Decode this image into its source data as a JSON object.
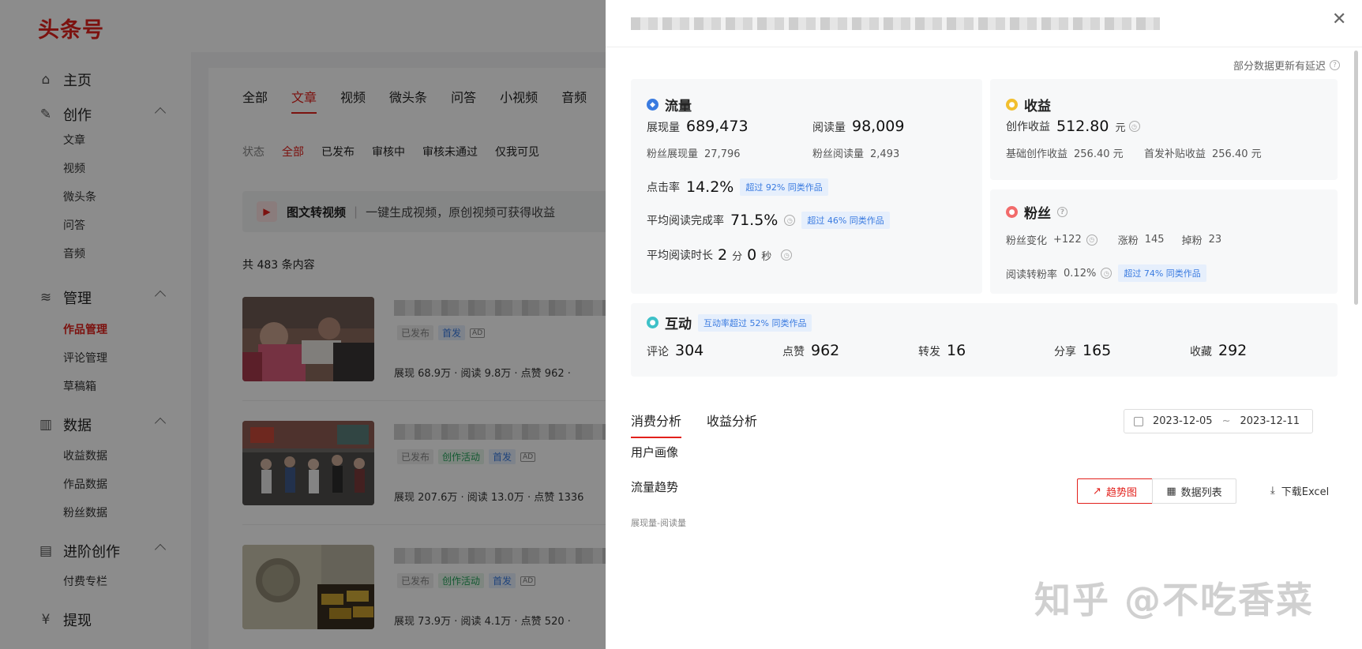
{
  "app": {
    "logo": "头条号",
    "sidebar": {
      "home": "主页",
      "create": "创作",
      "create_items": [
        "文章",
        "视频",
        "微头条",
        "问答",
        "音频"
      ],
      "manage": "管理",
      "manage_items": [
        "作品管理",
        "评论管理",
        "草稿箱"
      ],
      "data": "数据",
      "data_items": [
        "收益数据",
        "作品数据",
        "粉丝数据"
      ],
      "advanced": "进阶创作",
      "advanced_items": [
        "付费专栏"
      ],
      "withdraw": "提现"
    },
    "tabs": [
      "全部",
      "文章",
      "视频",
      "微头条",
      "问答",
      "小视频",
      "音频"
    ],
    "status_label": "状态",
    "status_filters": [
      "全部",
      "已发布",
      "审核中",
      "审核未通过",
      "仅我可见"
    ],
    "promo": {
      "title": "图文转视频",
      "desc": "一键生成视频，原创视频可获得收益"
    },
    "count": "共 483 条内容",
    "articles": [
      {
        "status": "已发布",
        "tags": [
          "首发"
        ],
        "ad": "AD",
        "stats": "展现 68.9万 · 阅读 9.8万 · 点赞 962 ·"
      },
      {
        "status": "已发布",
        "tags": [
          "创作活动",
          "首发"
        ],
        "ad": "AD",
        "stats": "展现 207.6万 · 阅读 13.0万 · 点赞 1336"
      },
      {
        "status": "已发布",
        "tags": [
          "创作活动",
          "首发"
        ],
        "ad": "AD",
        "stats": "展现 73.9万 · 阅读 4.1万 · 点赞 520 ·"
      }
    ]
  },
  "drawer": {
    "delay_note": "部分数据更新有延迟",
    "traffic": {
      "title": "流量",
      "impressions_label": "展现量",
      "impressions": "689,473",
      "reads_label": "阅读量",
      "reads": "98,009",
      "fan_impressions_label": "粉丝展现量",
      "fan_impressions": "27,796",
      "fan_reads_label": "粉丝阅读量",
      "fan_reads": "2,493",
      "ctr_label": "点击率",
      "ctr": "14.2%",
      "ctr_badge": "超过 92% 同类作品",
      "completion_label": "平均阅读完成率",
      "completion": "71.5%",
      "completion_badge": "超过 46% 同类作品",
      "duration_label": "平均阅读时长",
      "duration_min": "2",
      "min_unit": "分",
      "duration_sec": "0",
      "sec_unit": "秒"
    },
    "income": {
      "title": "收益",
      "creation_label": "创作收益",
      "creation": "512.80",
      "unit": "元",
      "basic_label": "基础创作收益",
      "basic": "256.40 元",
      "subsidy_label": "首发补贴收益",
      "subsidy": "256.40 元"
    },
    "fans": {
      "title": "粉丝",
      "change_label": "粉丝变化",
      "change": "+122",
      "gain_label": "涨粉",
      "gain": "145",
      "loss_label": "掉粉",
      "loss": "23",
      "conversion_label": "阅读转粉率",
      "conversion": "0.12%",
      "conversion_badge": "超过 74% 同类作品"
    },
    "interaction": {
      "title": "互动",
      "badge": "互动率超过 52% 同类作品",
      "comments_label": "评论",
      "comments": "304",
      "likes_label": "点赞",
      "likes": "962",
      "reposts_label": "转发",
      "reposts": "16",
      "shares_label": "分享",
      "shares": "165",
      "favorites_label": "收藏",
      "favorites": "292"
    },
    "subtabs": [
      "消费分析",
      "收益分析"
    ],
    "date_start": "2023-12-05",
    "date_sep": "~",
    "date_end": "2023-12-11",
    "user_profile": "用户画像",
    "traffic_trend": "流量趋势",
    "trend_button": "趋势图",
    "list_button": "数据列表",
    "download": "下载Excel",
    "legend": "展现量-阅读量"
  },
  "watermark": "知乎 @不吃香菜"
}
